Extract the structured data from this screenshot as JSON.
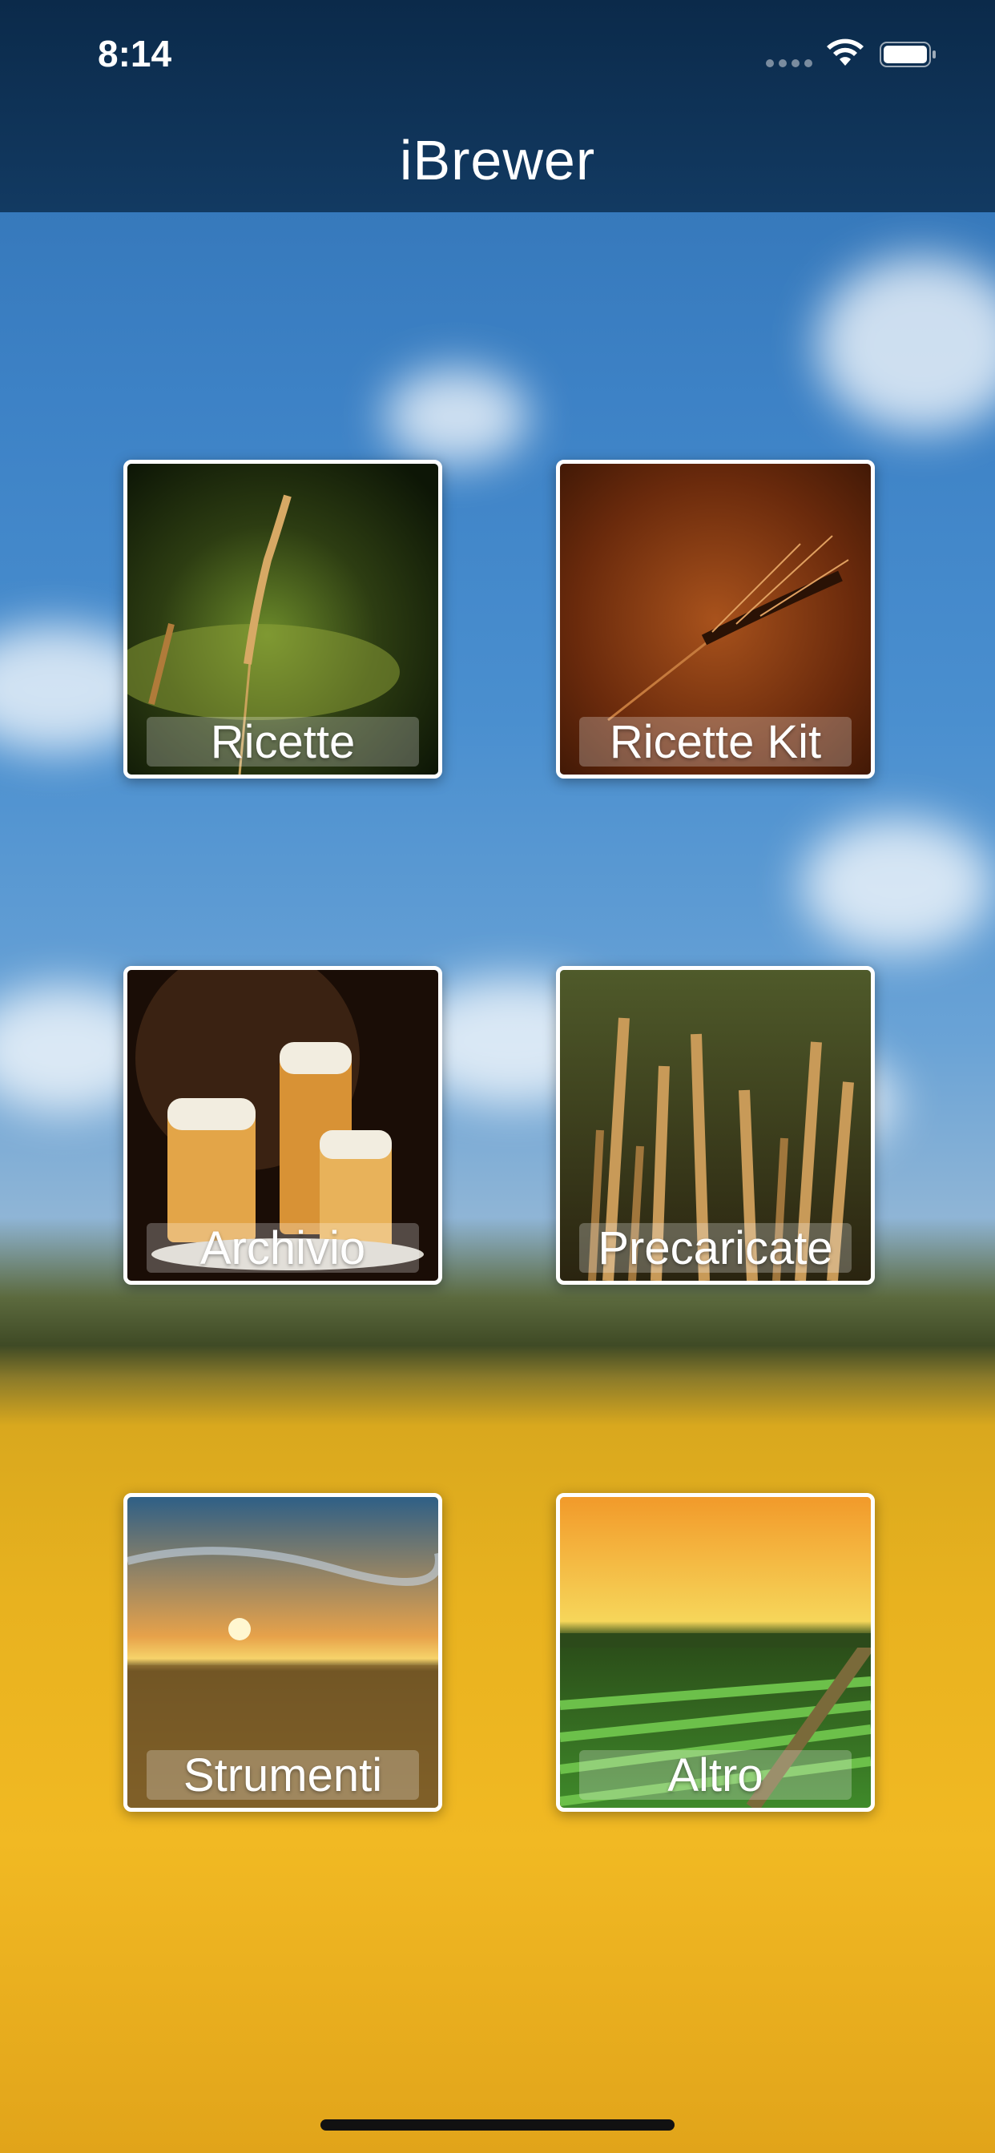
{
  "status_bar": {
    "time": "8:14"
  },
  "nav": {
    "title": "iBrewer"
  },
  "tiles": [
    {
      "label": "Ricette"
    },
    {
      "label": "Ricette Kit"
    },
    {
      "label": "Archivio"
    },
    {
      "label": "Precaricate"
    },
    {
      "label": "Strumenti"
    },
    {
      "label": "Altro"
    }
  ],
  "icons": {
    "wifi": "wifi-icon",
    "battery": "battery-icon",
    "signal": "signal-dots-icon"
  }
}
